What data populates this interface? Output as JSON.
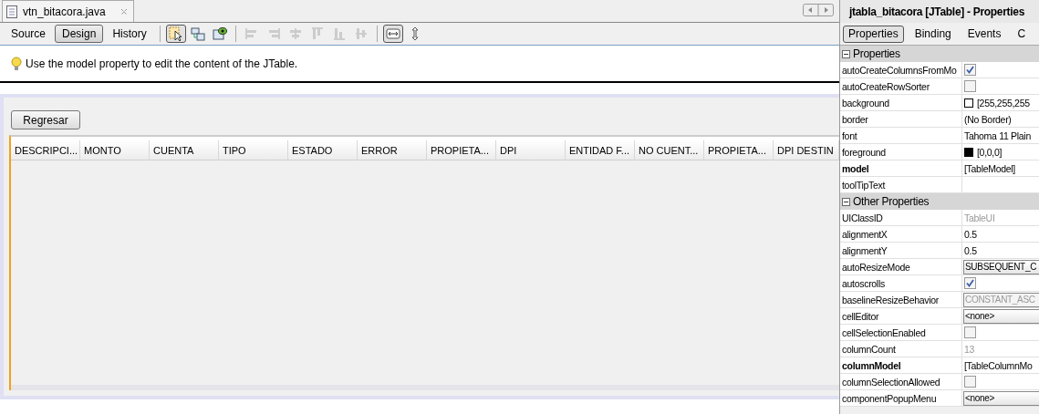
{
  "editor_tab": {
    "title": "vtn_bitacora.java"
  },
  "view_tabs": [
    {
      "label": "Source",
      "selected": false
    },
    {
      "label": "Design",
      "selected": true
    },
    {
      "label": "History",
      "selected": false
    }
  ],
  "toolbar_buttons": [
    {
      "kind": "selection",
      "selected": true
    },
    {
      "kind": "connection",
      "selected": false
    },
    {
      "kind": "preview",
      "selected": false
    },
    {
      "kind": "align-left",
      "selected": false
    },
    {
      "kind": "align-right",
      "selected": false
    },
    {
      "kind": "center-h",
      "selected": false
    },
    {
      "kind": "align-top",
      "selected": false
    },
    {
      "kind": "align-bottom",
      "selected": false
    },
    {
      "kind": "center-v",
      "selected": false
    },
    {
      "kind": "resize-h",
      "selected": true
    },
    {
      "kind": "resize-v",
      "selected": false
    }
  ],
  "hint": "Use the model property to edit the content of the JTable.",
  "form": {
    "button": "Regresar",
    "table_columns": [
      "DESCRIPCI...",
      "MONTO",
      "CUENTA",
      "TIPO",
      "ESTADO",
      "ERROR",
      "PROPIETA...",
      "DPI",
      "ENTIDAD F...",
      "NO CUENT...",
      "PROPIETA...",
      "DPI DESTIN"
    ]
  },
  "properties_panel": {
    "title": "jtabla_bitacora [JTable] - Properties",
    "tabs": [
      {
        "label": "Properties",
        "selected": true
      },
      {
        "label": "Binding",
        "selected": false
      },
      {
        "label": "Events",
        "selected": false
      },
      {
        "label": "C",
        "selected": false
      }
    ],
    "sections": [
      {
        "title": "Properties",
        "expanded": true,
        "rows": [
          {
            "name": "autoCreateColumnsFromMo",
            "bold": false,
            "kind": "checkbox",
            "checked": true
          },
          {
            "name": "autoCreateRowSorter",
            "bold": false,
            "kind": "checkbox",
            "checked": false
          },
          {
            "name": "background",
            "bold": false,
            "kind": "color",
            "color": "#ffffff",
            "value": "[255,255,255"
          },
          {
            "name": "border",
            "bold": false,
            "kind": "text",
            "value": "(No Border)"
          },
          {
            "name": "font",
            "bold": false,
            "kind": "text",
            "value": "Tahoma 11 Plain"
          },
          {
            "name": "foreground",
            "bold": false,
            "kind": "color",
            "color": "#000000",
            "value": "[0,0,0]"
          },
          {
            "name": "model",
            "bold": true,
            "kind": "text",
            "value": "[TableModel]"
          },
          {
            "name": "toolTipText",
            "bold": false,
            "kind": "text"
          }
        ]
      },
      {
        "title": "Other Properties",
        "expanded": true,
        "rows": [
          {
            "name": "UIClassID",
            "bold": false,
            "kind": "readonly",
            "value": "TableUI"
          },
          {
            "name": "alignmentX",
            "bold": false,
            "kind": "text",
            "value": "0.5"
          },
          {
            "name": "alignmentY",
            "bold": false,
            "kind": "text",
            "value": "0.5"
          },
          {
            "name": "autoResizeMode",
            "bold": false,
            "kind": "combo",
            "disabled": false,
            "value": "SUBSEQUENT_C"
          },
          {
            "name": "autoscrolls",
            "bold": false,
            "kind": "checkbox",
            "checked": true
          },
          {
            "name": "baselineResizeBehavior",
            "bold": false,
            "kind": "combo",
            "disabled": true,
            "value": "CONSTANT_ASC"
          },
          {
            "name": "cellEditor",
            "bold": false,
            "kind": "combo",
            "disabled": false,
            "value": "<none>"
          },
          {
            "name": "cellSelectionEnabled",
            "bold": false,
            "kind": "checkbox",
            "checked": false
          },
          {
            "name": "columnCount",
            "bold": false,
            "kind": "readonly",
            "value": "13"
          },
          {
            "name": "columnModel",
            "bold": true,
            "kind": "text",
            "value": "[TableColumnMo"
          },
          {
            "name": "columnSelectionAllowed",
            "bold": false,
            "kind": "checkbox",
            "checked": false
          },
          {
            "name": "componentPopupMenu",
            "bold": false,
            "kind": "combo",
            "disabled": false,
            "value": "<none>"
          }
        ]
      }
    ]
  }
}
